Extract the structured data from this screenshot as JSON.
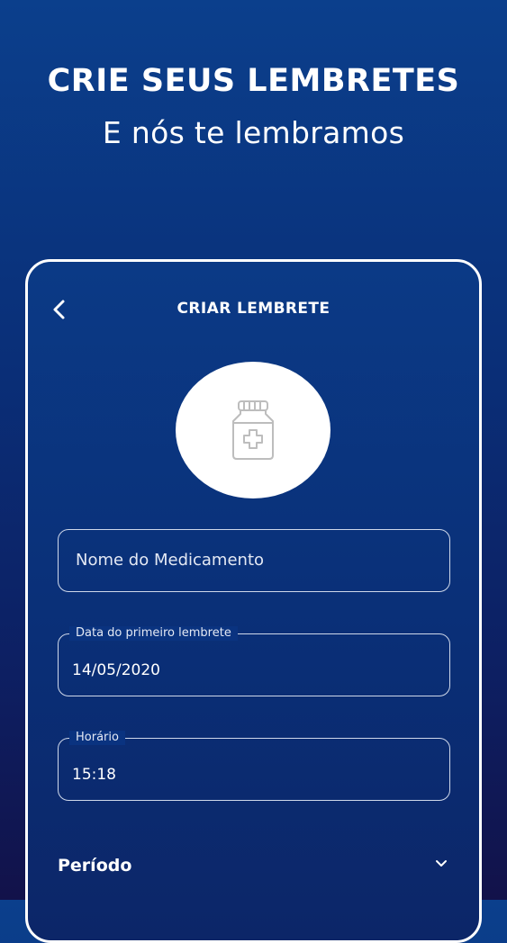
{
  "promo": {
    "headline": "CRIE SEUS LEMBRETES",
    "subheadline": "E nós te lembramos"
  },
  "screen": {
    "title": "CRIAR LEMBRETE",
    "back_icon": "chevron-left-icon",
    "photo_icon": "medicine-bottle-icon"
  },
  "form": {
    "medication_name": {
      "placeholder": "Nome do Medicamento",
      "value": ""
    },
    "first_reminder_date": {
      "label": "Data do primeiro lembrete",
      "value": "14/05/2020"
    },
    "time": {
      "label": "Horário",
      "value": "15:18"
    },
    "period": {
      "label": "Período",
      "icon": "chevron-down-icon"
    }
  },
  "colors": {
    "background_top": "#0b3f8c",
    "background_bottom": "#12124a",
    "field_border": "#cfd8ea",
    "text": "#ffffff"
  }
}
